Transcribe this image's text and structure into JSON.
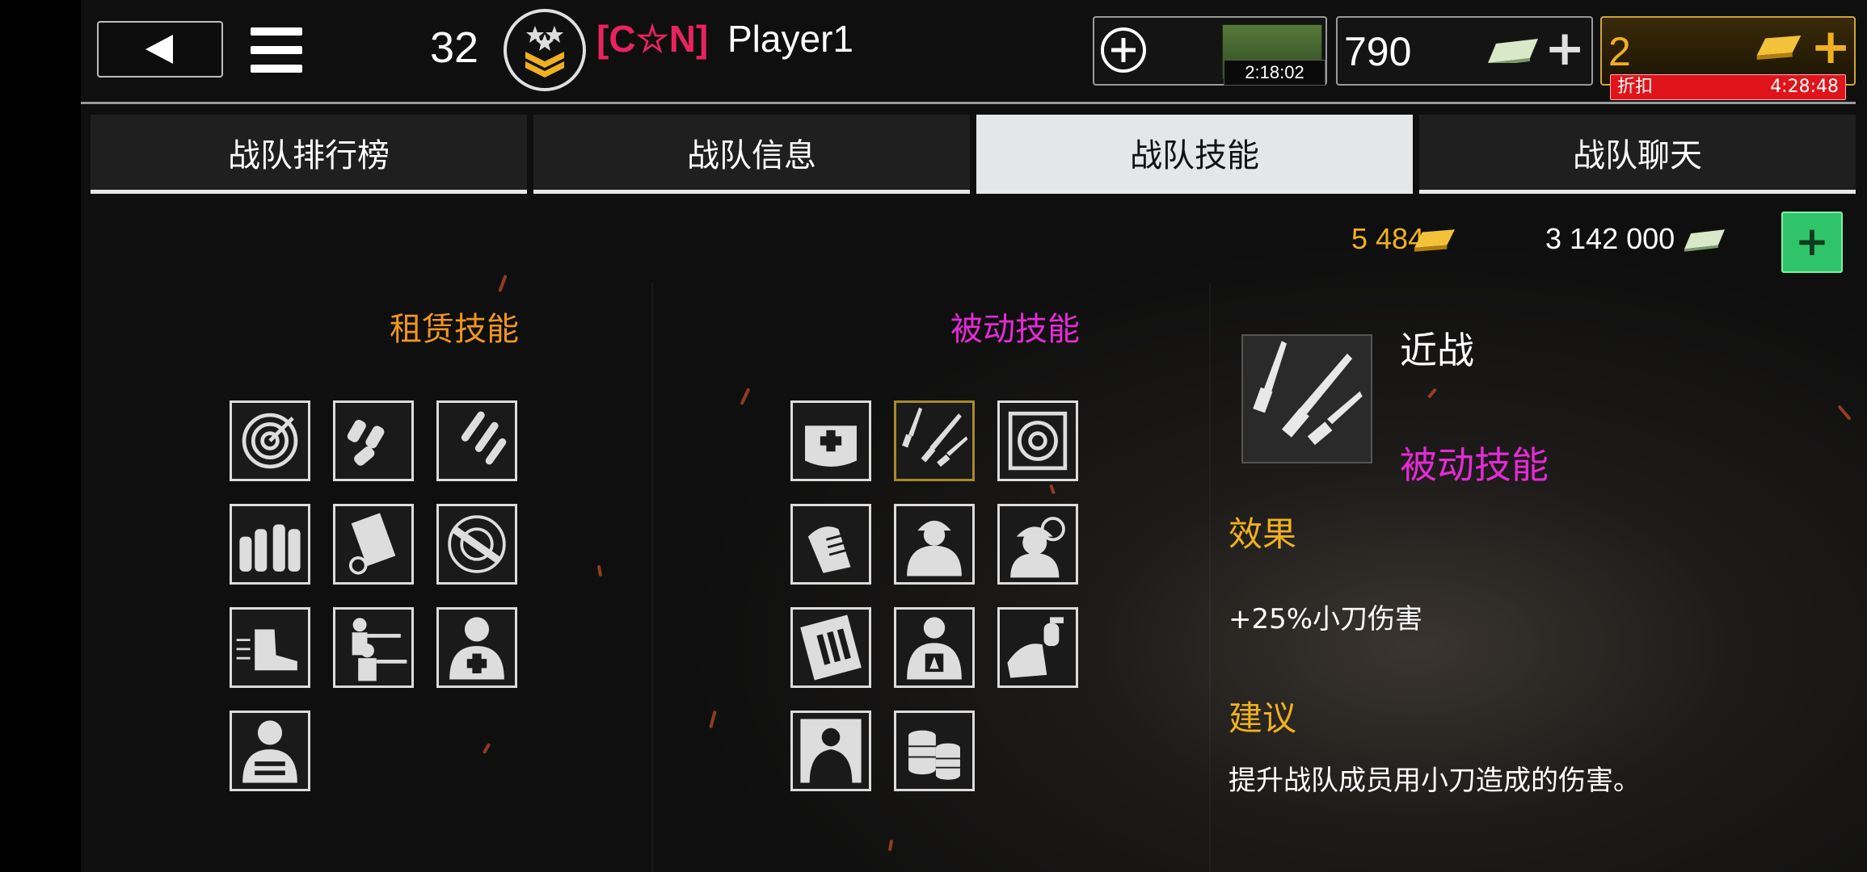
{
  "header": {
    "level": "32",
    "clan_tag": "[C☆N]",
    "player_name": "Player1",
    "crate_timer": "2:18:02",
    "cash_value": "790",
    "gold_value": "2",
    "discount_label": "折扣",
    "discount_timer": "4:28:48"
  },
  "tabs": [
    {
      "label": "战队排行榜"
    },
    {
      "label": "战队信息"
    },
    {
      "label": "战队技能"
    },
    {
      "label": "战队聊天"
    }
  ],
  "active_tab": 2,
  "clan_currency": {
    "gold": "5 484",
    "cash": "3 142 000"
  },
  "rental_skills": {
    "title": "租赁技能",
    "icons": [
      "radar-icon",
      "grenades-icon",
      "bullets-icon",
      "ammo-icon",
      "magazine-icon",
      "rifle-target-icon",
      "running-boot-icon",
      "soldiers-firing-icon",
      "medic-icon",
      "vest-soldier-icon"
    ]
  },
  "passive_skills": {
    "title": "被动技能",
    "icons": [
      "medkit-bag-icon",
      "knives-icon",
      "target-scope-icon",
      "hand-magazine-icon",
      "helmet-soldier-icon",
      "soldier-crosshair-icon",
      "ammo-box-icon",
      "soldier-badge-icon",
      "grenade-hand-icon",
      "flag-soldier-icon",
      "coin-stacks-icon"
    ]
  },
  "detail": {
    "name": "近战",
    "category": "被动技能",
    "effect_heading": "效果",
    "effect_text": "+25%小刀伤害",
    "advice_heading": "建议",
    "advice_text": "提升战队成员用小刀造成的伤害。"
  },
  "colors": {
    "clan_tag": "#e8235f",
    "rental_title": "#f0961e",
    "passive_title": "#e62ad6",
    "heading": "#f0b01e",
    "gold_text": "#f0b01e",
    "add_button": "#2fc46a",
    "discount": "#e0141a"
  }
}
